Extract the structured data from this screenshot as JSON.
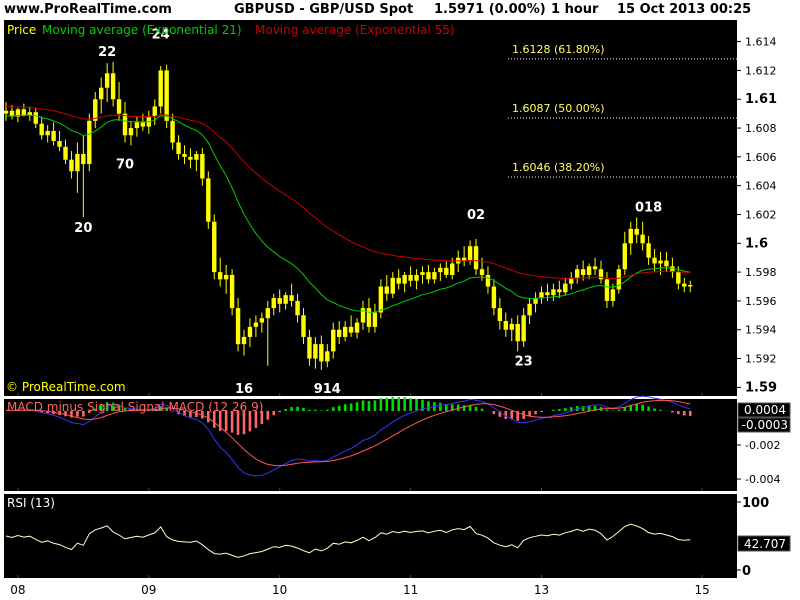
{
  "header": {
    "site": "www.ProRealTime.com",
    "symbol": "GBPUSD - GBP/USD Spot",
    "price": "1.5971 (0.00%)",
    "interval": "1 hour",
    "datetime": "15 Oct 2013 00:25"
  },
  "watermark": "© ProRealTime.com",
  "colors": {
    "background": "#000000",
    "candle": "#ffff00",
    "ema21": "#00cc00",
    "ema55": "#cc0000",
    "fib": "#ffff66",
    "macd_line": "#3333ff",
    "signal_line": "#ff5555",
    "hist_pos": "#00dd00",
    "hist_neg": "#ff6666",
    "rsi": "#ffffcc",
    "price_box": "#000000"
  },
  "chart_data": [
    {
      "type": "candlestick",
      "legend": [
        "Price",
        "Moving average (Exponential 21)",
        "Moving average (Exponential 55)"
      ],
      "x_ticks": [
        {
          "label": "08",
          "i": 2
        },
        {
          "label": "09",
          "i": 24
        },
        {
          "label": "10",
          "i": 46
        },
        {
          "label": "11",
          "i": 68
        },
        {
          "label": "13",
          "i": 90
        },
        {
          "label": "15",
          "i": 117
        }
      ],
      "y_ticks": [
        "1.614",
        "1.612",
        "1.61",
        "1.608",
        "1.606",
        "1.604",
        "1.602",
        "1.6",
        "1.598",
        "1.596",
        "1.594",
        "1.592",
        "1.59"
      ],
      "ylim": [
        1.5894,
        1.6155
      ],
      "fib_levels": [
        {
          "value": 1.6128,
          "label": "1.6128 (61.80%)"
        },
        {
          "value": 1.6087,
          "label": "1.6087 (50.00%)"
        },
        {
          "value": 1.6046,
          "label": "1.6046 (38.20%)"
        }
      ],
      "annotations": [
        {
          "text": "22",
          "i": 17,
          "price": 1.613
        },
        {
          "text": "24",
          "i": 26,
          "price": 1.6142
        },
        {
          "text": "70",
          "i": 20,
          "price": 1.6052
        },
        {
          "text": "20",
          "i": 13,
          "price": 1.6008
        },
        {
          "text": "02",
          "i": 79,
          "price": 1.6017
        },
        {
          "text": "16",
          "i": 40,
          "price": 1.5896
        },
        {
          "text": "914",
          "i": 54,
          "price": 1.5896
        },
        {
          "text": "23",
          "i": 87,
          "price": 1.5915
        },
        {
          "text": "018",
          "i": 108,
          "price": 1.6022
        }
      ],
      "candles": [
        [
          1.609,
          1.6098,
          1.6085,
          1.6092
        ],
        [
          1.6092,
          1.6096,
          1.6086,
          1.6088
        ],
        [
          1.6088,
          1.6094,
          1.6084,
          1.6093
        ],
        [
          1.6093,
          1.6097,
          1.6088,
          1.6089
        ],
        [
          1.6089,
          1.6095,
          1.6085,
          1.6091
        ],
        [
          1.6091,
          1.6094,
          1.608,
          1.6083
        ],
        [
          1.6083,
          1.6088,
          1.6072,
          1.6075
        ],
        [
          1.6075,
          1.6082,
          1.607,
          1.6078
        ],
        [
          1.6078,
          1.6084,
          1.6068,
          1.6071
        ],
        [
          1.6071,
          1.6078,
          1.6064,
          1.6067
        ],
        [
          1.6067,
          1.6072,
          1.6055,
          1.6058
        ],
        [
          1.6058,
          1.6064,
          1.6045,
          1.605
        ],
        [
          1.605,
          1.607,
          1.6035,
          1.6062
        ],
        [
          1.6062,
          1.6075,
          1.6018,
          1.6055
        ],
        [
          1.6055,
          1.609,
          1.605,
          1.6085
        ],
        [
          1.6085,
          1.6105,
          1.608,
          1.61
        ],
        [
          1.61,
          1.6115,
          1.609,
          1.6108
        ],
        [
          1.6108,
          1.6125,
          1.6098,
          1.6118
        ],
        [
          1.6118,
          1.6126,
          1.6095,
          1.61
        ],
        [
          1.61,
          1.6112,
          1.6085,
          1.609
        ],
        [
          1.609,
          1.6098,
          1.607,
          1.6075
        ],
        [
          1.6075,
          1.6085,
          1.6068,
          1.608
        ],
        [
          1.608,
          1.6088,
          1.6074,
          1.6084
        ],
        [
          1.6084,
          1.609,
          1.6078,
          1.6081
        ],
        [
          1.6081,
          1.6092,
          1.6076,
          1.6088
        ],
        [
          1.6088,
          1.61,
          1.6082,
          1.6095
        ],
        [
          1.6095,
          1.6123,
          1.609,
          1.612
        ],
        [
          1.612,
          1.6124,
          1.608,
          1.6085
        ],
        [
          1.6085,
          1.609,
          1.6065,
          1.607
        ],
        [
          1.607,
          1.6075,
          1.6058,
          1.6062
        ],
        [
          1.6062,
          1.6068,
          1.6055,
          1.606
        ],
        [
          1.606,
          1.6066,
          1.6052,
          1.6058
        ],
        [
          1.6058,
          1.6064,
          1.605,
          1.6062
        ],
        [
          1.6062,
          1.6066,
          1.604,
          1.6045
        ],
        [
          1.6045,
          1.605,
          1.601,
          1.6015
        ],
        [
          1.6015,
          1.602,
          1.5975,
          1.598
        ],
        [
          1.598,
          1.599,
          1.597,
          1.5975
        ],
        [
          1.5975,
          1.5985,
          1.5965,
          1.5978
        ],
        [
          1.5978,
          1.5982,
          1.595,
          1.5955
        ],
        [
          1.5955,
          1.5962,
          1.5925,
          1.593
        ],
        [
          1.593,
          1.594,
          1.5922,
          1.5935
        ],
        [
          1.5935,
          1.5948,
          1.5928,
          1.5942
        ],
        [
          1.5942,
          1.595,
          1.5935,
          1.5945
        ],
        [
          1.5945,
          1.5952,
          1.5938,
          1.5948
        ],
        [
          1.5948,
          1.596,
          1.5915,
          1.5955
        ],
        [
          1.5955,
          1.5965,
          1.595,
          1.5962
        ],
        [
          1.5962,
          1.5968,
          1.5952,
          1.5958
        ],
        [
          1.5958,
          1.5966,
          1.5954,
          1.5964
        ],
        [
          1.5964,
          1.5972,
          1.5956,
          1.596
        ],
        [
          1.596,
          1.5965,
          1.5945,
          1.595
        ],
        [
          1.595,
          1.5955,
          1.593,
          1.5935
        ],
        [
          1.5935,
          1.594,
          1.5915,
          1.592
        ],
        [
          1.592,
          1.5935,
          1.5913,
          1.593
        ],
        [
          1.593,
          1.5936,
          1.5912,
          1.5918
        ],
        [
          1.5918,
          1.593,
          1.5914,
          1.5925
        ],
        [
          1.5925,
          1.5945,
          1.592,
          1.594
        ],
        [
          1.594,
          1.5946,
          1.593,
          1.5935
        ],
        [
          1.5935,
          1.5946,
          1.5932,
          1.5942
        ],
        [
          1.5942,
          1.595,
          1.5935,
          1.5938
        ],
        [
          1.5938,
          1.5948,
          1.5934,
          1.5945
        ],
        [
          1.5945,
          1.596,
          1.594,
          1.5955
        ],
        [
          1.5955,
          1.5962,
          1.5938,
          1.5942
        ],
        [
          1.5942,
          1.5958,
          1.5938,
          1.5952
        ],
        [
          1.5952,
          1.5975,
          1.5948,
          1.597
        ],
        [
          1.597,
          1.5978,
          1.596,
          1.5965
        ],
        [
          1.5965,
          1.598,
          1.5962,
          1.5976
        ],
        [
          1.5976,
          1.5982,
          1.5968,
          1.5972
        ],
        [
          1.5972,
          1.598,
          1.5966,
          1.5978
        ],
        [
          1.5978,
          1.5984,
          1.597,
          1.5974
        ],
        [
          1.5974,
          1.5982,
          1.5968,
          1.5978
        ],
        [
          1.5978,
          1.5984,
          1.5972,
          1.598
        ],
        [
          1.598,
          1.5985,
          1.5972,
          1.5975
        ],
        [
          1.5975,
          1.5983,
          1.5972,
          1.598
        ],
        [
          1.598,
          1.5986,
          1.5974,
          1.5983
        ],
        [
          1.5983,
          1.5988,
          1.5976,
          1.5978
        ],
        [
          1.5978,
          1.599,
          1.5975,
          1.5986
        ],
        [
          1.5986,
          1.5995,
          1.598,
          1.599
        ],
        [
          1.599,
          1.5998,
          1.5984,
          1.5988
        ],
        [
          1.5988,
          1.6002,
          1.5985,
          1.5998
        ],
        [
          1.5998,
          1.6003,
          1.5978,
          1.5982
        ],
        [
          1.5982,
          1.599,
          1.5974,
          1.5978
        ],
        [
          1.5978,
          1.5984,
          1.5965,
          1.597
        ],
        [
          1.597,
          1.5975,
          1.595,
          1.5955
        ],
        [
          1.5955,
          1.5962,
          1.594,
          1.5946
        ],
        [
          1.5946,
          1.5952,
          1.5935,
          1.594
        ],
        [
          1.594,
          1.5948,
          1.5932,
          1.5944
        ],
        [
          1.5944,
          1.595,
          1.5925,
          1.5932
        ],
        [
          1.5932,
          1.5955,
          1.5928,
          1.595
        ],
        [
          1.595,
          1.5962,
          1.5944,
          1.5958
        ],
        [
          1.5958,
          1.5966,
          1.5952,
          1.5962
        ],
        [
          1.5962,
          1.597,
          1.5958,
          1.5966
        ],
        [
          1.5966,
          1.5972,
          1.596,
          1.5964
        ],
        [
          1.5964,
          1.5972,
          1.596,
          1.5968
        ],
        [
          1.5968,
          1.5974,
          1.5962,
          1.5966
        ],
        [
          1.5966,
          1.5976,
          1.5964,
          1.5972
        ],
        [
          1.5972,
          1.598,
          1.5968,
          1.5976
        ],
        [
          1.5976,
          1.5985,
          1.5972,
          1.5982
        ],
        [
          1.5982,
          1.5988,
          1.5974,
          1.5978
        ],
        [
          1.5978,
          1.5986,
          1.5975,
          1.5984
        ],
        [
          1.5984,
          1.599,
          1.5978,
          1.5982
        ],
        [
          1.5982,
          1.5988,
          1.5972,
          1.5975
        ],
        [
          1.5975,
          1.598,
          1.5955,
          1.596
        ],
        [
          1.596,
          1.5972,
          1.5956,
          1.5968
        ],
        [
          1.5968,
          1.5985,
          1.5965,
          1.5982
        ],
        [
          1.5982,
          1.6008,
          1.5978,
          1.6
        ],
        [
          1.6,
          1.6015,
          1.5992,
          1.601
        ],
        [
          1.601,
          1.6018,
          1.6,
          1.6006
        ],
        [
          1.6006,
          1.6015,
          1.5995,
          1.6
        ],
        [
          1.6,
          1.6005,
          1.5985,
          1.599
        ],
        [
          1.599,
          1.5996,
          1.598,
          1.5986
        ],
        [
          1.5986,
          1.5994,
          1.5978,
          1.5988
        ],
        [
          1.5988,
          1.5994,
          1.598,
          1.5984
        ],
        [
          1.5984,
          1.599,
          1.5976,
          1.598
        ],
        [
          1.598,
          1.5984,
          1.5968,
          1.5972
        ],
        [
          1.5972,
          1.5976,
          1.5966,
          1.597
        ],
        [
          1.597,
          1.5974,
          1.5966,
          1.5971
        ]
      ]
    },
    {
      "type": "line",
      "title": "MACD minus Signal Signal MACD (12 26 9)",
      "y_ticks": [
        "-0.002",
        "-0.004"
      ],
      "ylim": [
        -0.0047,
        0.0007
      ],
      "price_boxes": [
        "0.0004",
        "-0.0003"
      ]
    },
    {
      "type": "line",
      "title": "RSI (13)",
      "y_ticks": [
        "100",
        "0"
      ],
      "ylim": [
        0,
        100
      ],
      "last_value": "42.707"
    }
  ]
}
